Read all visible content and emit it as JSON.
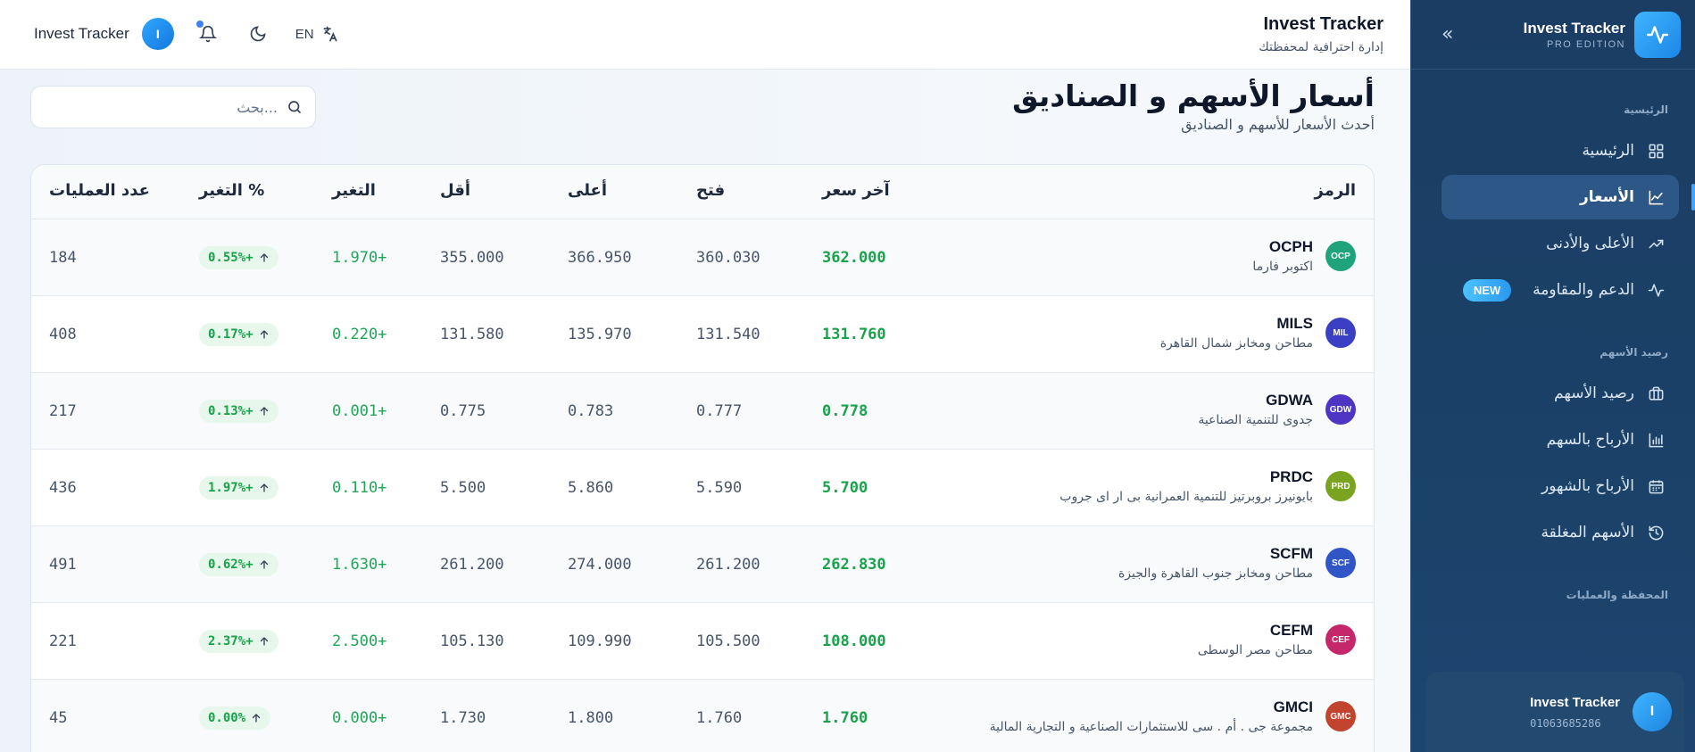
{
  "sidebar": {
    "brand": "Invest Tracker",
    "edition": "PRO EDITION",
    "collapse_icon": "«",
    "sections": [
      {
        "label": "الرئيسية"
      },
      {
        "label": "رصيد الأسهم"
      },
      {
        "label": "المحفظة والعمليات"
      }
    ],
    "items": [
      {
        "label": "الرئيسية",
        "icon": "grid-icon"
      },
      {
        "label": "الأسعار",
        "icon": "chart-line-icon",
        "active": true
      },
      {
        "label": "الأعلى والأدنى",
        "icon": "trending-up-icon"
      },
      {
        "label": "الدعم والمقاومة",
        "icon": "activity-icon",
        "badge": "NEW"
      },
      {
        "label": "رصيد الأسهم",
        "icon": "briefcase-icon"
      },
      {
        "label": "الأرباح بالسهم",
        "icon": "bar-chart-icon"
      },
      {
        "label": "الأرباح بالشهور",
        "icon": "calendar-icon"
      },
      {
        "label": "الأسهم المغلقة",
        "icon": "history-icon"
      }
    ],
    "user": {
      "name": "Invest Tracker",
      "phone": "01063685286",
      "initial": "I"
    }
  },
  "header": {
    "app_title": "Invest Tracker",
    "app_subtitle": "إدارة احترافية لمحفظتك",
    "user_name": "Invest Tracker",
    "user_initial": "I",
    "language": "EN"
  },
  "page": {
    "title": "أسعار الأسهم و الصناديق",
    "subtitle": "أحدث الأسعار للأسهم و الصناديق",
    "search_placeholder": "بحث..."
  },
  "table": {
    "headers": {
      "symbol": "الرمز",
      "last": "آخر سعر",
      "open": "فتح",
      "high": "أعلى",
      "low": "أقل",
      "change": "التغير",
      "change_pct": "التغير %",
      "trades": "عدد العمليات"
    },
    "rows": [
      {
        "logo": "OCP",
        "logo_color": "#1fa37a",
        "code": "OCPH",
        "name": "اكتوبر فارما",
        "last": "362.000",
        "open": "360.030",
        "high": "366.950",
        "low": "355.000",
        "change": "1.970+",
        "pct": "0.55%+",
        "trades": "184"
      },
      {
        "logo": "MIL",
        "logo_color": "#3a3fc4",
        "code": "MILS",
        "name": "مطاحن ومخابز شمال القاهرة",
        "last": "131.760",
        "open": "131.540",
        "high": "135.970",
        "low": "131.580",
        "change": "0.220+",
        "pct": "0.17%+",
        "trades": "408"
      },
      {
        "logo": "GDW",
        "logo_color": "#4f35c4",
        "code": "GDWA",
        "name": "جدوى للتنمية الصناعية",
        "last": "0.778",
        "open": "0.777",
        "high": "0.783",
        "low": "0.775",
        "change": "0.001+",
        "pct": "0.13%+",
        "trades": "217"
      },
      {
        "logo": "PRD",
        "logo_color": "#7aa320",
        "code": "PRDC",
        "name": "بايونيرز بروبرتيز للتنمية العمرانية بى ار اى جروب",
        "last": "5.700",
        "open": "5.590",
        "high": "5.860",
        "low": "5.500",
        "change": "0.110+",
        "pct": "1.97%+",
        "trades": "436"
      },
      {
        "logo": "SCF",
        "logo_color": "#2f55c7",
        "code": "SCFM",
        "name": "مطاحن ومخابز جنوب القاهرة والجيزة",
        "last": "262.830",
        "open": "261.200",
        "high": "274.000",
        "low": "261.200",
        "change": "1.630+",
        "pct": "0.62%+",
        "trades": "491"
      },
      {
        "logo": "CEF",
        "logo_color": "#c4286a",
        "code": "CEFM",
        "name": "مطاحن مصر الوسطى",
        "last": "108.000",
        "open": "105.500",
        "high": "109.990",
        "low": "105.130",
        "change": "2.500+",
        "pct": "2.37%+",
        "trades": "221"
      },
      {
        "logo": "GMC",
        "logo_color": "#c2442e",
        "code": "GMCI",
        "name": "مجموعة جى . أم . سى للاستثمارات الصناعية و التجارية المالية",
        "last": "1.760",
        "open": "1.760",
        "high": "1.800",
        "low": "1.730",
        "change": "0.000+",
        "pct": "0.00%",
        "trades": "45"
      }
    ]
  }
}
